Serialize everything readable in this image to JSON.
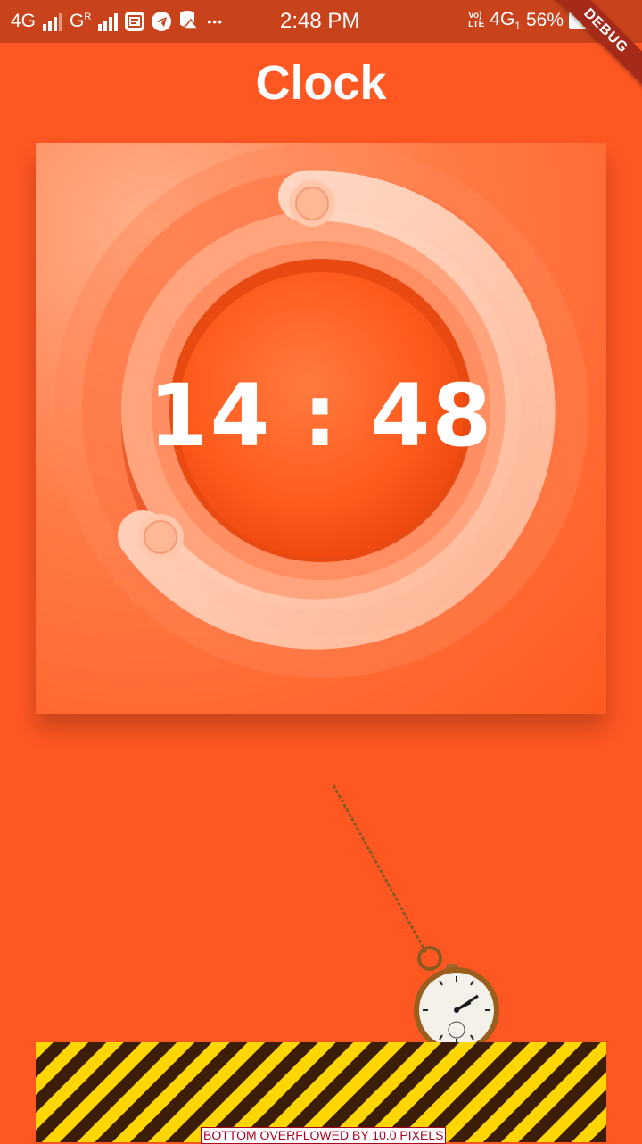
{
  "status_bar": {
    "left_network_1": "4G",
    "left_network_2": "G",
    "left_network_2_sup": "R",
    "more_dots": "•••",
    "time": "2:48 PM",
    "volte_top": "Vo)",
    "volte_bottom": "LTE",
    "right_network": "4G",
    "right_network_sub": "1",
    "battery_percent": "56%",
    "battery_level": 0.56,
    "icons": [
      "message-icon",
      "telegram-icon",
      "data-saver-icon"
    ]
  },
  "debug_banner": "DEBUG",
  "app": {
    "title": "Clock",
    "time_display": "14 : 48"
  },
  "overflow_warning": "BOTTOM OVERFLOWED BY 10.0 PIXELS",
  "colors": {
    "background": "#ff5722",
    "status_bar": "#c8431b",
    "stripe_yellow": "#ffd600",
    "stripe_dark": "#3b1d08"
  }
}
